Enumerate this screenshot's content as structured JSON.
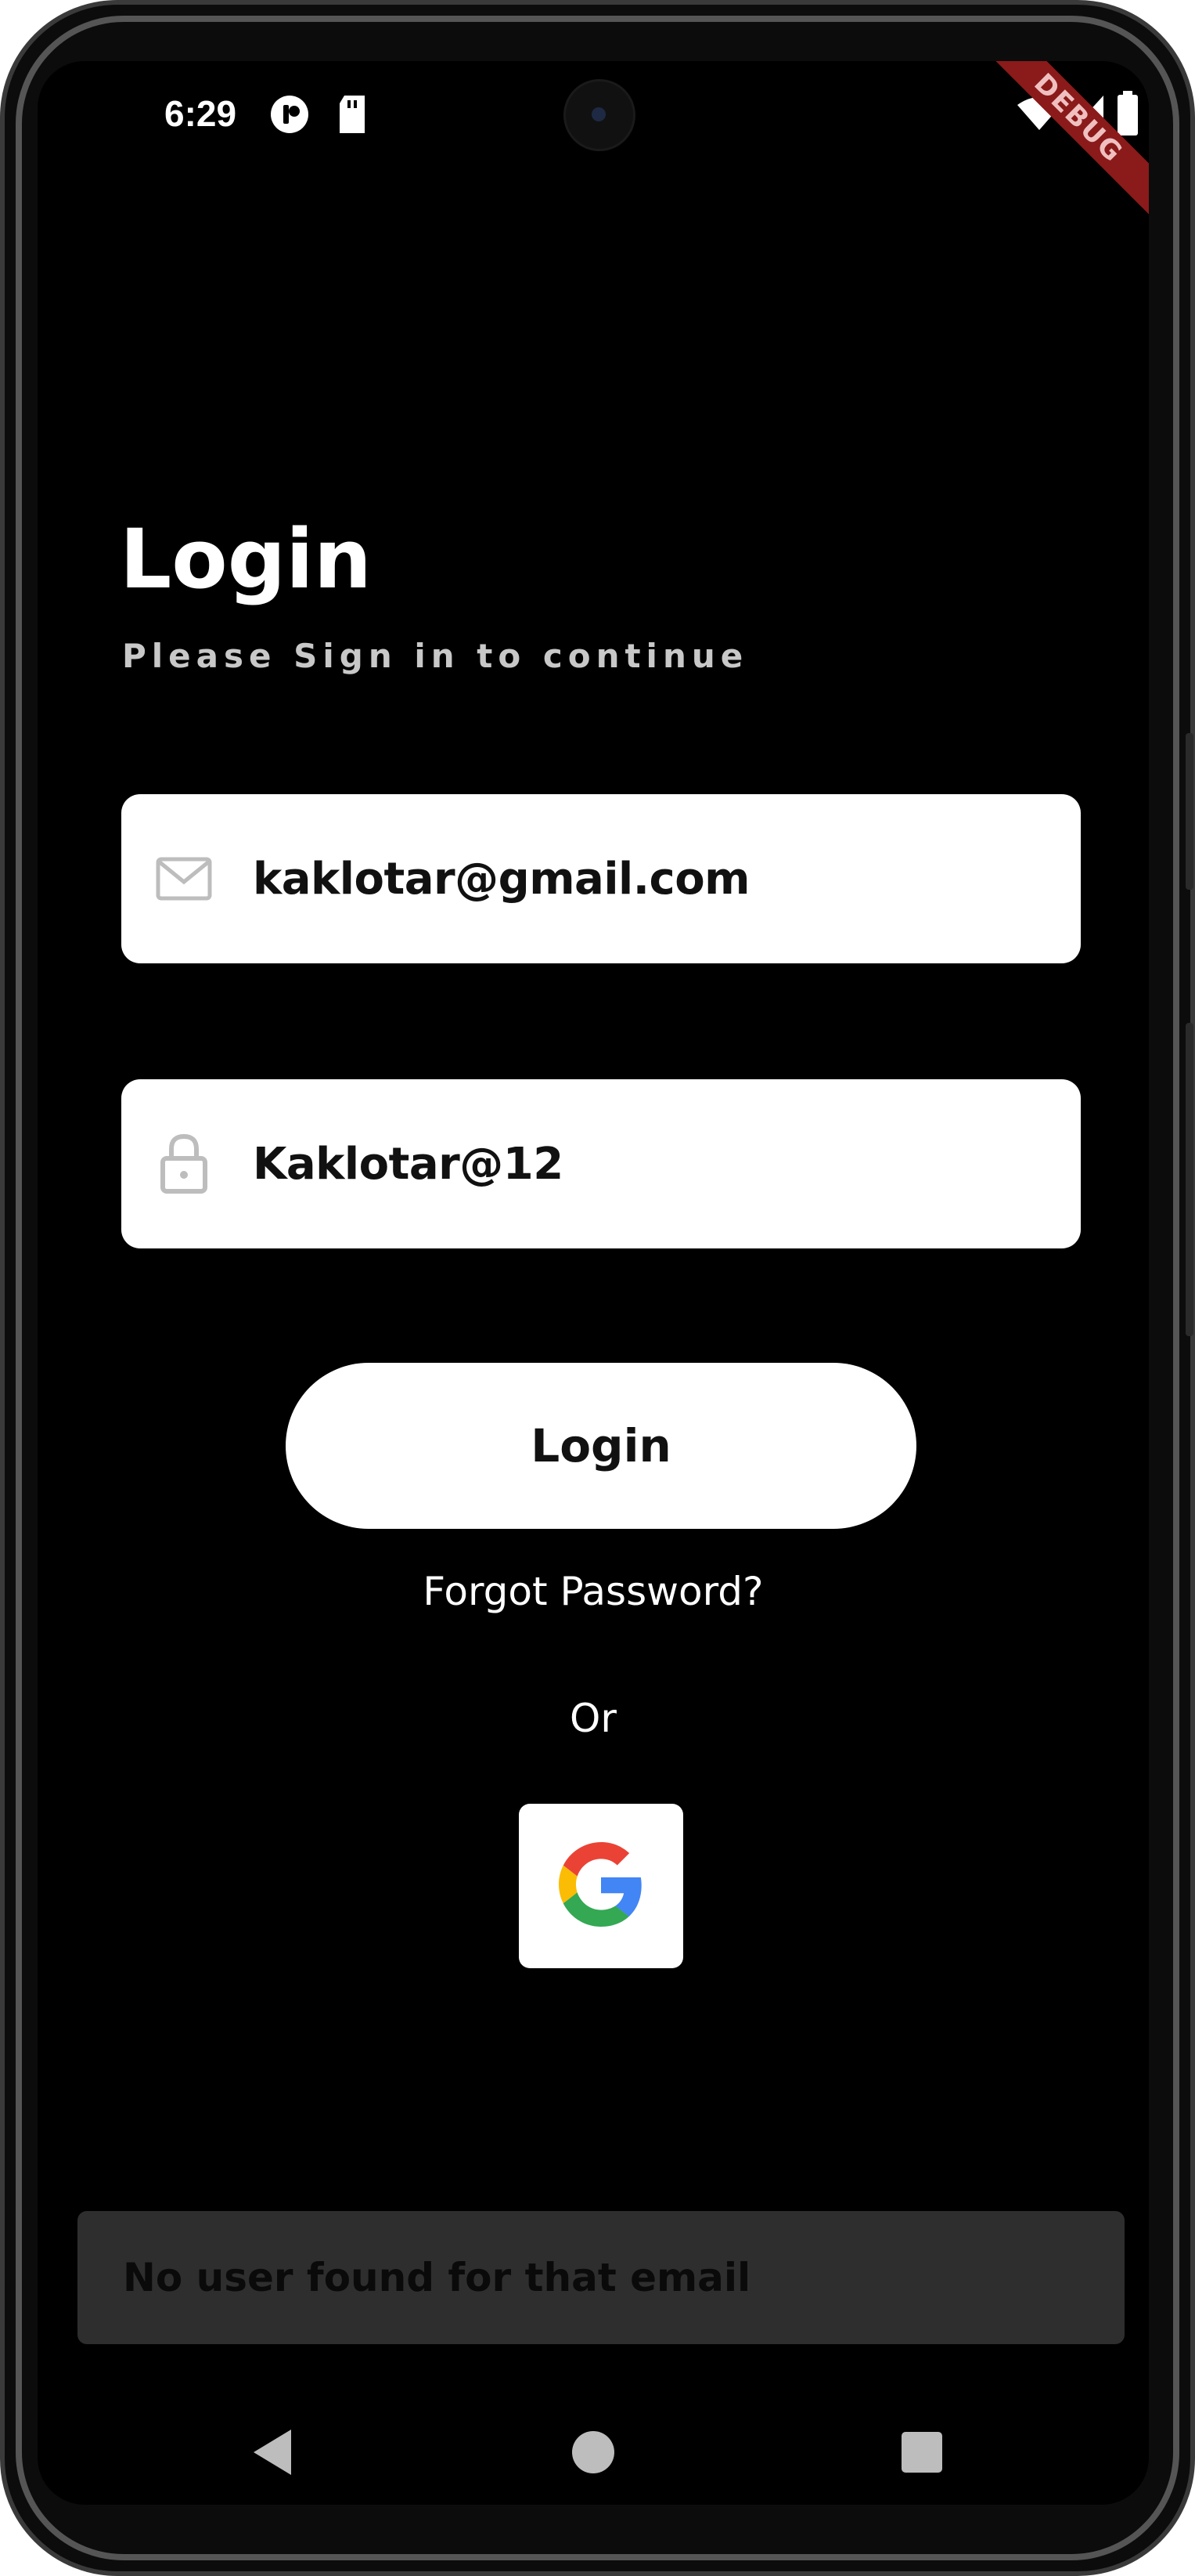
{
  "status_bar": {
    "time": "6:29",
    "icons": [
      "circle-p-icon",
      "sd-card-icon",
      "wifi-icon",
      "signal-icon",
      "battery-icon"
    ]
  },
  "debug_banner": "DEBUG",
  "login": {
    "title": "Login",
    "subtitle": "Please Sign in to continue",
    "email": {
      "icon": "mail-icon",
      "value": "kaklotar@gmail.com"
    },
    "password": {
      "icon": "lock-icon",
      "value": "Kaklotar@12"
    },
    "login_button": "Login",
    "forgot_password": "Forgot Password?",
    "or_label": "Or",
    "google_button_icon": "google-icon"
  },
  "snackbar": {
    "message": "No user found for that email"
  },
  "nav": {
    "items": [
      "back-icon",
      "home-icon",
      "recents-icon"
    ]
  },
  "colors": {
    "background": "#000000",
    "field": "#ffffff",
    "snackbar": "#2e2e2e",
    "debug_banner": "#8b1a1a"
  }
}
